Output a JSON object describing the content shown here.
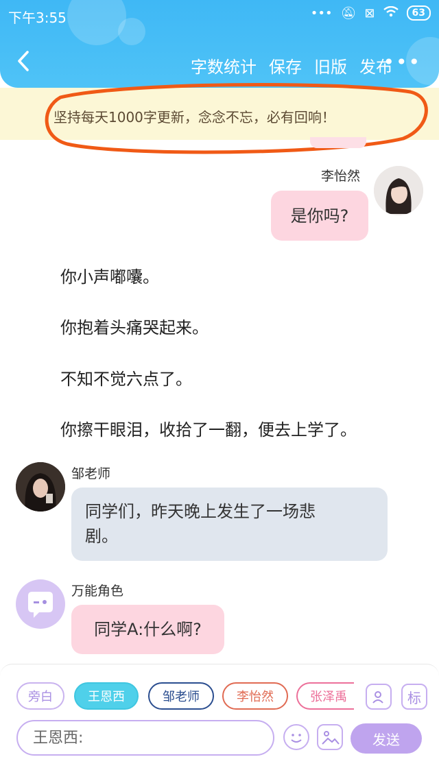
{
  "status_bar": {
    "time": "下午3:55",
    "battery": "63"
  },
  "header": {
    "actions": [
      "字数统计",
      "保存",
      "旧版",
      "发布"
    ],
    "more": "•••"
  },
  "notice": {
    "text": "坚持每天1000字更新，念念不忘，必有回响！"
  },
  "chat": {
    "msg1": {
      "speaker": "李怡然",
      "text": "是你吗?"
    },
    "narration": [
      "你小声嘟囔。",
      "你抱着头痛哭起来。",
      "不知不觉六点了。",
      "你擦干眼泪，收拾了一翻，便去上学了。"
    ],
    "msg2": {
      "speaker": "邹老师",
      "line1": "同学们，昨天晚上发生了一场悲",
      "line2": "剧。"
    },
    "msg3": {
      "speaker": "万能角色",
      "text": "同学A:什么啊?"
    }
  },
  "toolbar": {
    "characters": [
      "旁白",
      "王恩西",
      "邹老师",
      "李怡然",
      "张泽禹"
    ],
    "mark_label": "标",
    "input_placeholder": "王恩西:",
    "send_label": "发送"
  },
  "colors": {
    "header": "#4fc3f7",
    "pink_bubble": "#fdd6e0",
    "gray_bubble": "#e0e6ee",
    "send": "#bfa4ee",
    "ring": "#f05a16"
  }
}
